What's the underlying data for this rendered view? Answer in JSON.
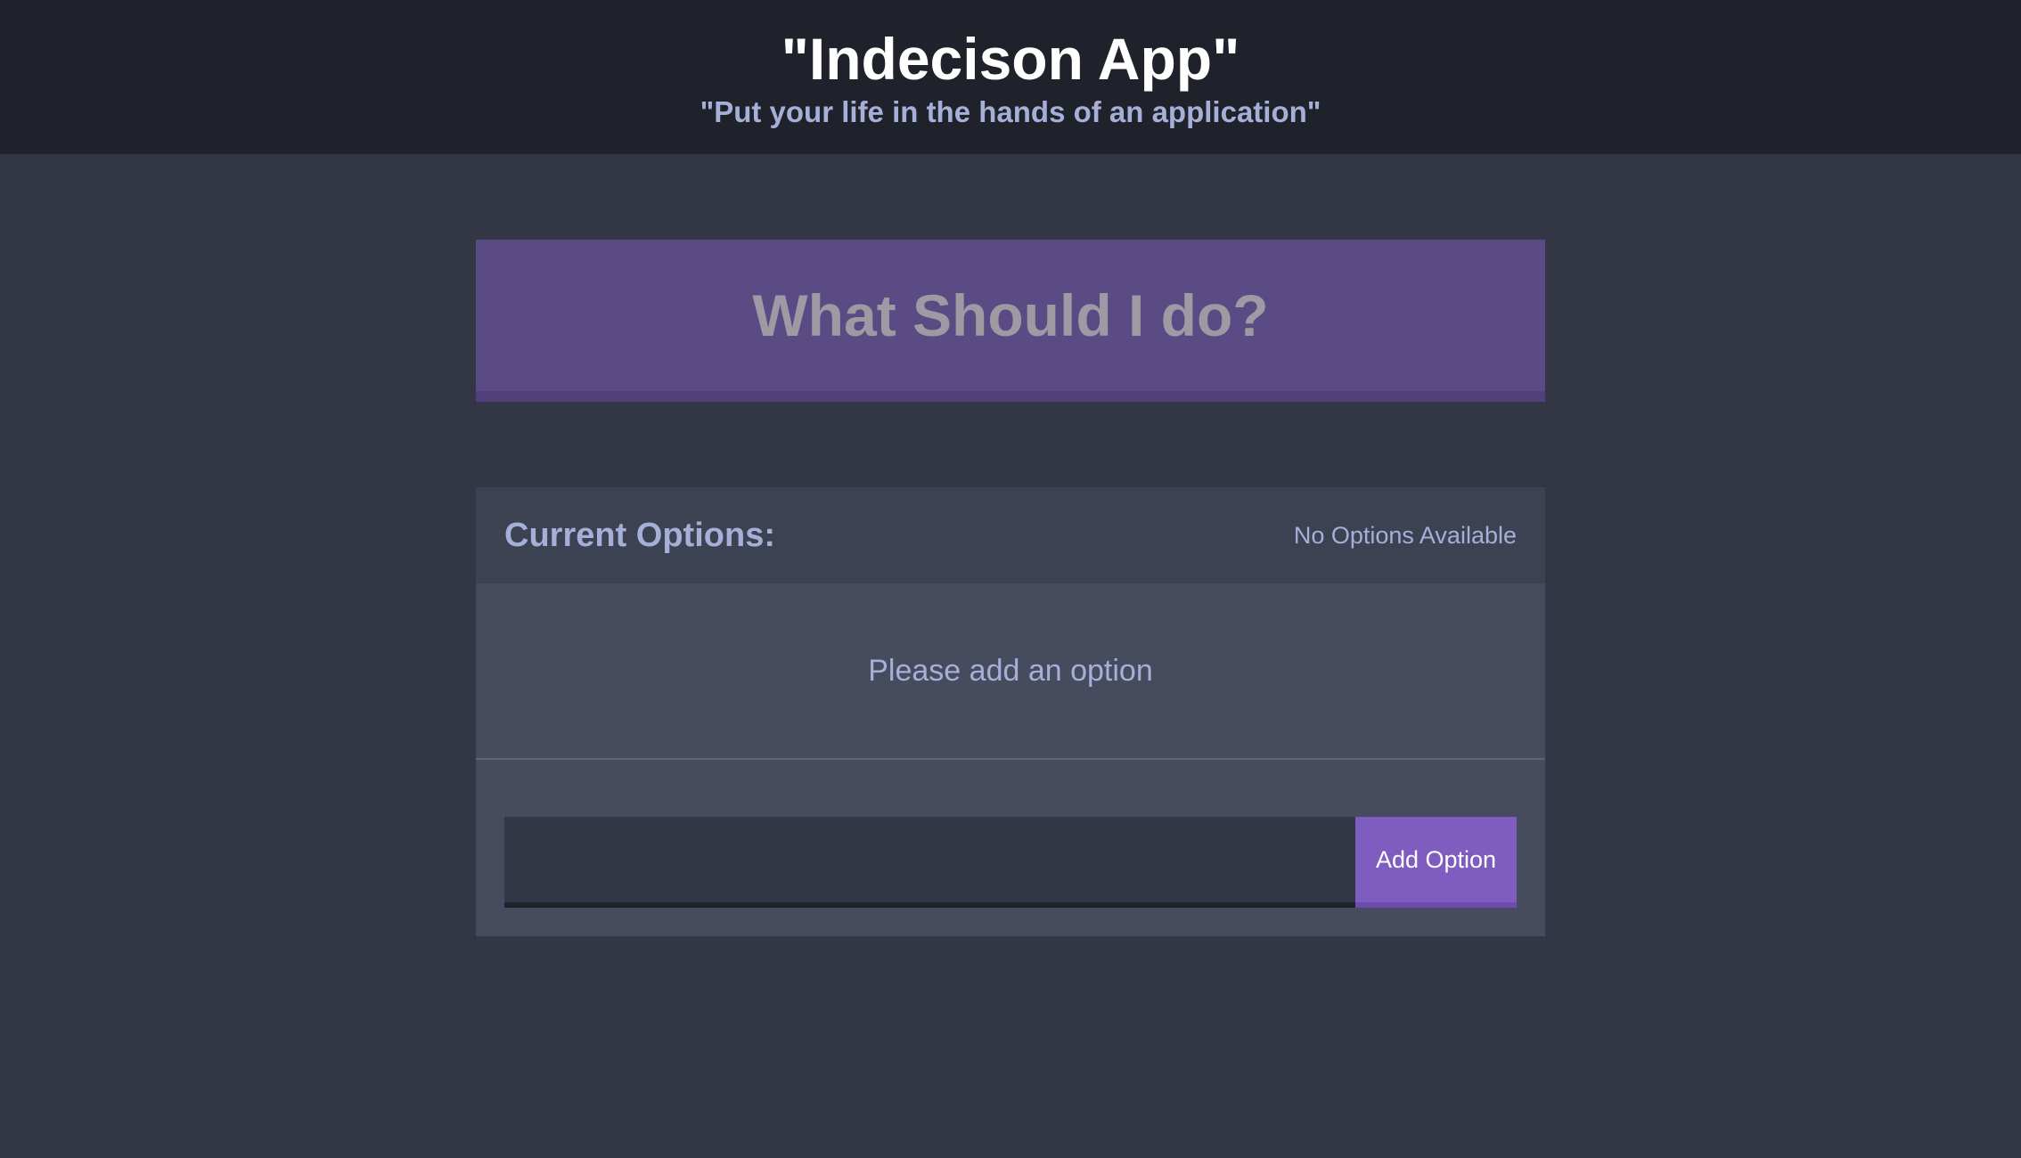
{
  "header": {
    "title": "\"Indecison App\"",
    "subtitle": "\"Put your life in the hands of an application\""
  },
  "action": {
    "button_label": "What Should I do?"
  },
  "options": {
    "title": "Current Options:",
    "status": "No Options Available",
    "empty_message": "Please add an option"
  },
  "add_option": {
    "input_value": "",
    "input_placeholder": "",
    "button_label": "Add Option"
  },
  "colors": {
    "page_background": "#333745",
    "header_background": "#20222b",
    "action_button": "#5b4b84",
    "add_button": "#7f5cc0",
    "text_primary": "#a5afd7"
  }
}
